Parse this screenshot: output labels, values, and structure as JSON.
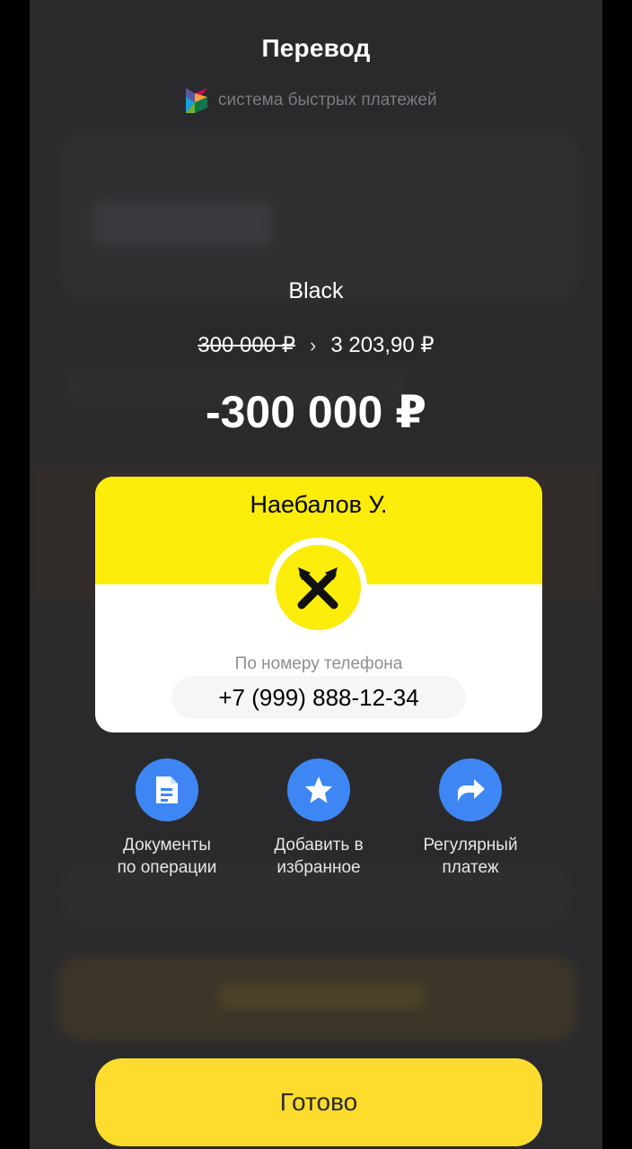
{
  "header": {
    "title": "Перевод",
    "sbp_label": "система быстрых платежей"
  },
  "transfer": {
    "recipient_label": "Black",
    "balance_before": "300 000 ₽",
    "balance_arrow": "›",
    "balance_after": "3 203,90 ₽",
    "amount": "-300 000 ₽"
  },
  "card": {
    "name": "Наебалов У.",
    "method_label": "По номеру телефона",
    "phone": "+7 (999) 888-12-34",
    "logo_icon": "raiffeisen-logo-icon"
  },
  "actions": [
    {
      "label": "Документы\nпо операции",
      "icon": "document-icon"
    },
    {
      "label": "Добавить в\nизбранное",
      "icon": "star-icon"
    },
    {
      "label": "Регулярный\nплатеж",
      "icon": "share-arrow-icon"
    }
  ],
  "footer": {
    "done_label": "Готово"
  },
  "colors": {
    "background": "#2a2a2d",
    "accent_yellow": "#fddc2e",
    "card_yellow": "#fbec0a",
    "action_blue": "#3f86f5"
  }
}
